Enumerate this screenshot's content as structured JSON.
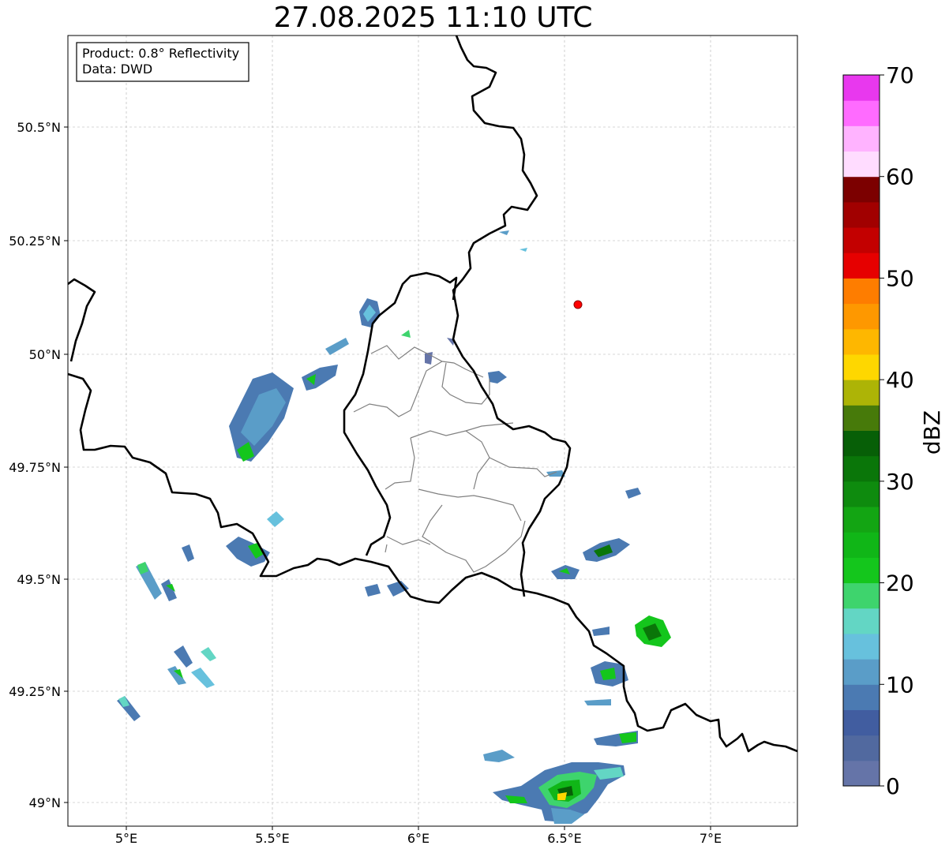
{
  "title": "27.08.2025 11:10 UTC",
  "info": {
    "product": "Product: 0.8° Reflectivity",
    "data": "Data: DWD"
  },
  "axes": {
    "lon_ticks": [
      "5°E",
      "5.5°E",
      "6°E",
      "6.5°E",
      "7°E"
    ],
    "lat_ticks": [
      "50.5°N",
      "50.25°N",
      "50°N",
      "49.75°N",
      "49.5°N",
      "49.25°N",
      "49°N"
    ]
  },
  "colorbar": {
    "label": "dBZ",
    "tick_labels": [
      "0",
      "10",
      "20",
      "30",
      "40",
      "50",
      "60",
      "70"
    ],
    "colors": [
      "#6574a8",
      "#51699f",
      "#415da0",
      "#4b7ab2",
      "#5a9dc8",
      "#67c1dd",
      "#63d6c4",
      "#3ed46d",
      "#14c61c",
      "#10b617",
      "#13a513",
      "#0e8b0e",
      "#0a7609",
      "#075f07",
      "#477a0a",
      "#adb406",
      "#fed700",
      "#feb700",
      "#fe9800",
      "#fe7d00",
      "#e60000",
      "#c30000",
      "#a10000",
      "#7c0000",
      "#ffdcff",
      "#ffb3ff",
      "#ff6bff",
      "#e838ee"
    ]
  },
  "radar_site": {
    "name": "radar-site",
    "color": "#ff0000"
  }
}
